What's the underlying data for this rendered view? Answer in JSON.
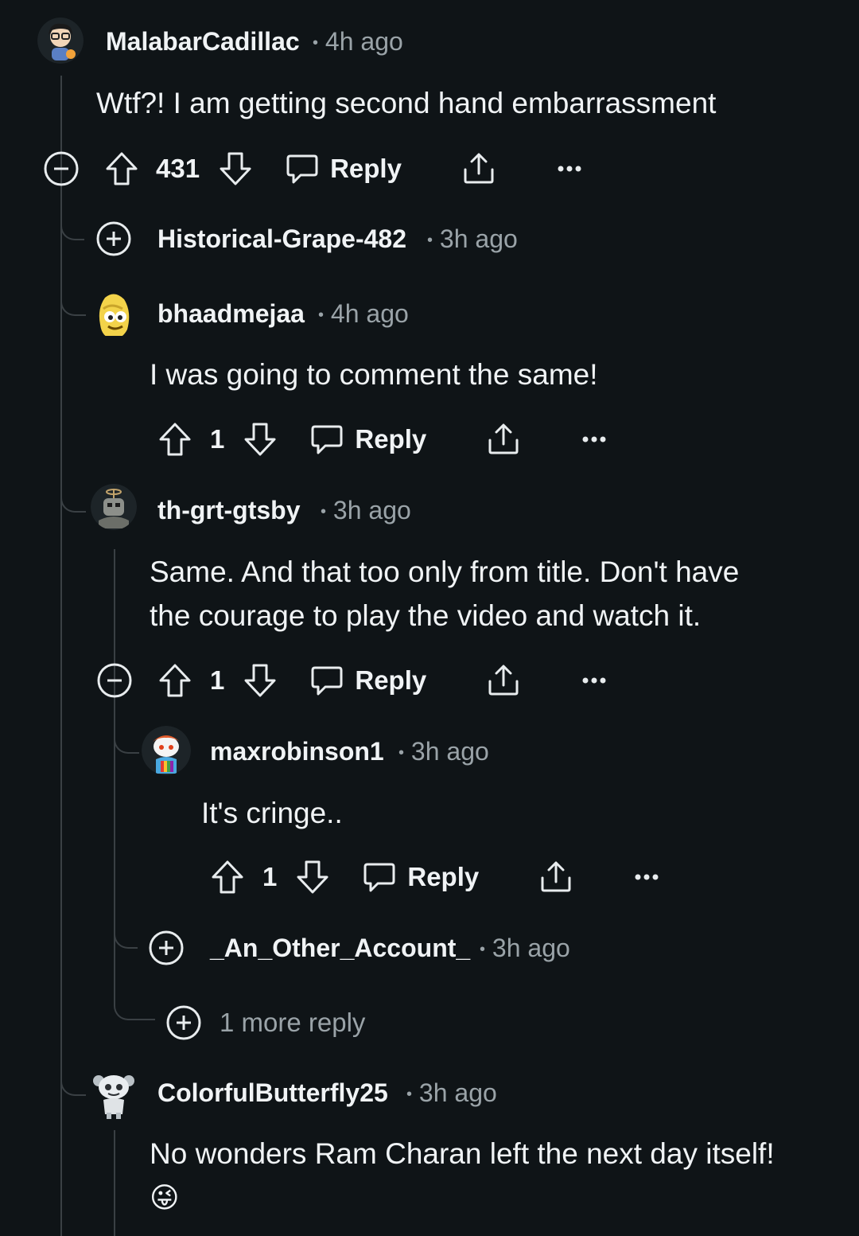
{
  "comments": [
    {
      "username": "MalabarCadillac",
      "time": "4h ago",
      "body": "Wtf?! I am getting second hand embarrassment",
      "votes": "431",
      "reply_label": "Reply"
    },
    {
      "username": "Historical-Grape-482",
      "time": "3h ago"
    },
    {
      "username": "bhaadmejaa",
      "time": "4h ago",
      "body": "I was going to comment the same!",
      "votes": "1",
      "reply_label": "Reply"
    },
    {
      "username": "th-grt-gtsby",
      "time": "3h ago",
      "body_line1": "Same. And that too only from title. Don't have",
      "body_line2": "the courage to play the video and watch it.",
      "votes": "1",
      "reply_label": "Reply"
    },
    {
      "username": "maxrobinson1",
      "time": "3h ago",
      "body": "It's cringe..",
      "votes": "1",
      "reply_label": "Reply"
    },
    {
      "username": "_An_Other_Account_",
      "time": "3h ago"
    },
    {
      "username": "ColorfulButterfly25",
      "time": "3h ago",
      "body": "No wonders Ram Charan left the next day itself!",
      "emoji": "😜"
    }
  ],
  "more_replies": "1 more reply",
  "separator": "•",
  "colors": {
    "background": "#0f1417",
    "text": "#f0f3f5",
    "muted": "#9aa3a8",
    "line": "#3a4044"
  },
  "icons": [
    "collapse-icon",
    "expand-icon",
    "upvote-icon",
    "downvote-icon",
    "reply-bubble-icon",
    "share-icon",
    "more-options-icon"
  ]
}
